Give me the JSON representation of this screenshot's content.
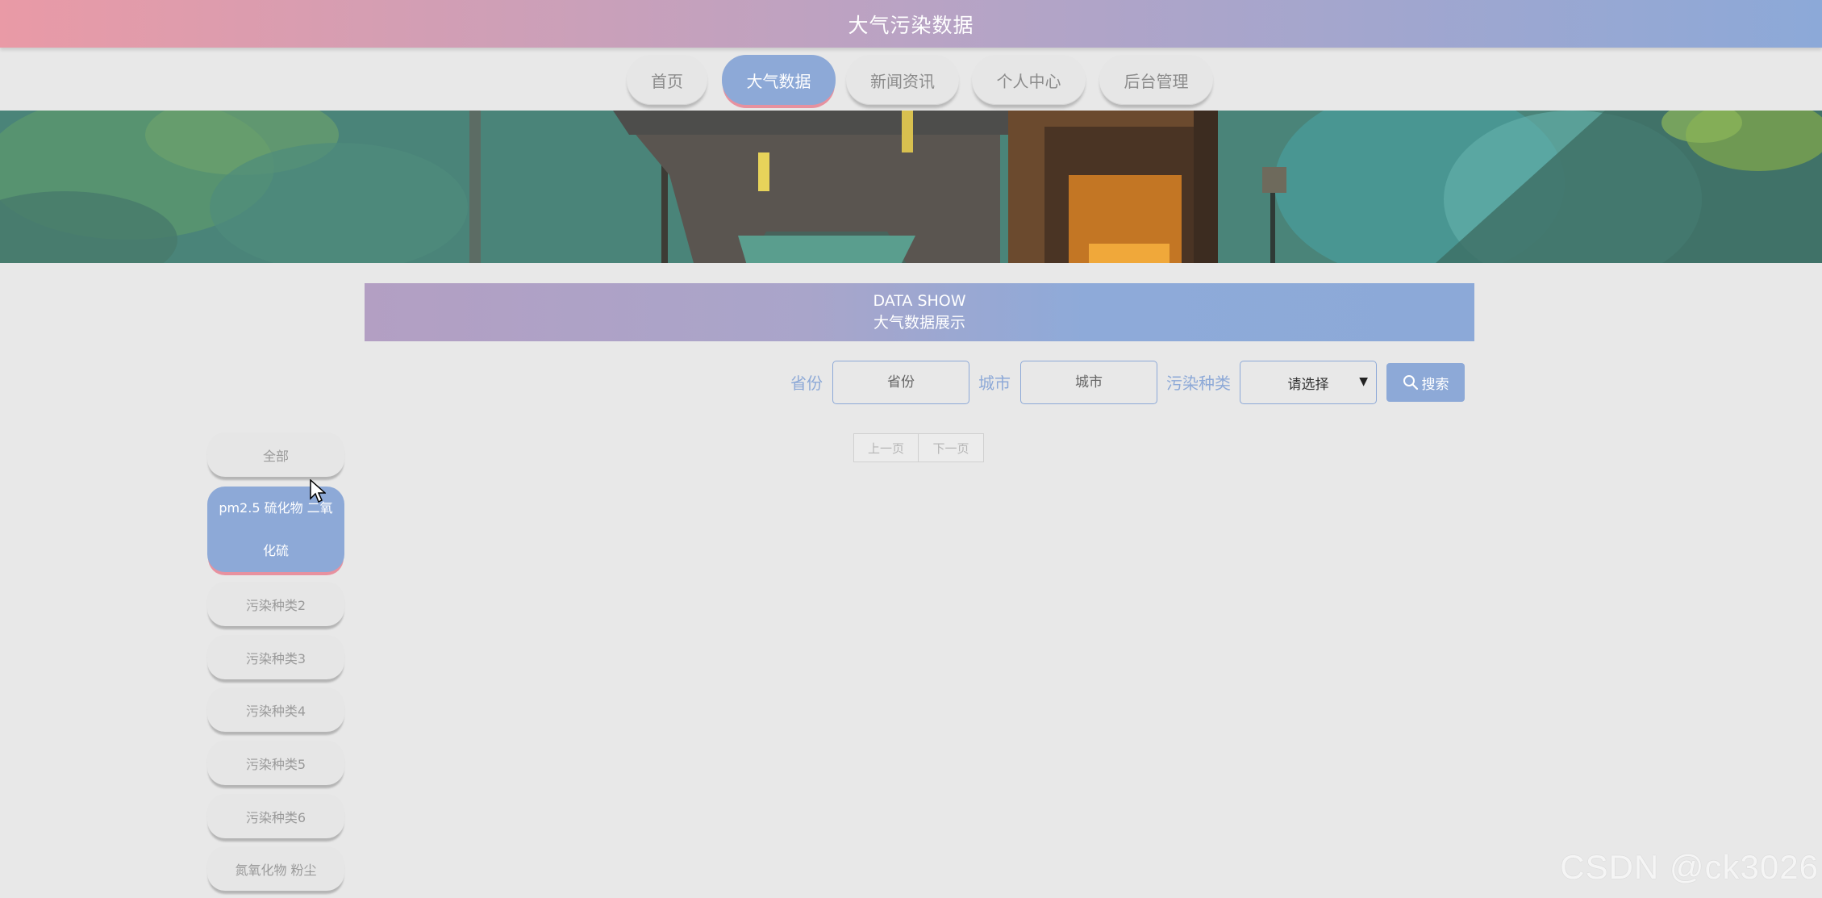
{
  "header": {
    "title": "大气污染数据"
  },
  "nav": {
    "items": [
      {
        "label": "首页"
      },
      {
        "label": "大气数据"
      },
      {
        "label": "新闻资讯"
      },
      {
        "label": "个人中心"
      },
      {
        "label": "后台管理"
      }
    ],
    "active_index": 1
  },
  "section": {
    "title_en": "DATA SHOW",
    "title_cn": "大气数据展示"
  },
  "search": {
    "province_label": "省份",
    "province_placeholder": "省份",
    "city_label": "城市",
    "city_placeholder": "城市",
    "type_label": "污染种类",
    "type_selected": "请选择",
    "button_label": "搜索"
  },
  "pager": {
    "prev": "上一页",
    "next": "下一页"
  },
  "sidebar": {
    "items": [
      {
        "label": "全部"
      },
      {
        "label": "pm2.5 硫化物 二氧化硫"
      },
      {
        "label": "污染种类2"
      },
      {
        "label": "污染种类3"
      },
      {
        "label": "污染种类4"
      },
      {
        "label": "污染种类5"
      },
      {
        "label": "污染种类6"
      },
      {
        "label": "氮氧化物 粉尘"
      }
    ],
    "active_index": 1
  },
  "watermark": "CSDN @ck3026",
  "colors": {
    "accent": "#8da9d7",
    "pink": "#e99aa6",
    "background": "#e8e8e8"
  }
}
